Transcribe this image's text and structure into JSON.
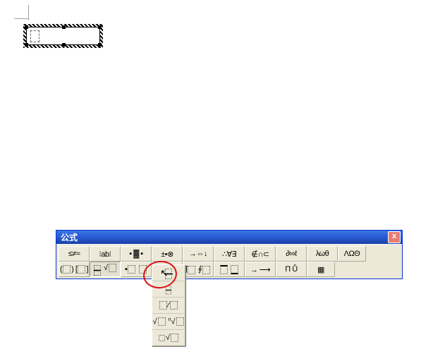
{
  "editor": {
    "placeholder_name": "equation-object",
    "slot_name": "input-slot"
  },
  "window": {
    "title": "公式",
    "close_label": "x"
  },
  "row1": [
    {
      "name": "relational-symbols",
      "label": "≤≠≈"
    },
    {
      "name": "spaces-dots",
      "label": "⁝ab⁝"
    },
    {
      "name": "embellishments",
      "label": "▪ ▓ ▪"
    },
    {
      "name": "operators",
      "label": "±•⊗"
    },
    {
      "name": "arrows",
      "label": "→⇔↓"
    },
    {
      "name": "logical",
      "label": "∴∀∃"
    },
    {
      "name": "set-theory",
      "label": "∉∩⊂"
    },
    {
      "name": "misc-symbols",
      "label": "∂∞ℓ"
    },
    {
      "name": "greek-lower",
      "label": "λωθ"
    },
    {
      "name": "greek-upper",
      "label": "ΛΩΘ"
    }
  ],
  "row2": [
    {
      "name": "fences",
      "type": "fence"
    },
    {
      "name": "fractions-radicals",
      "type": "frac",
      "pressed": true
    },
    {
      "name": "sub-super",
      "type": "subsup"
    },
    {
      "name": "summation",
      "type": "sum"
    },
    {
      "name": "integral",
      "type": "int"
    },
    {
      "name": "over-under-bar",
      "type": "bar"
    },
    {
      "name": "labeled-arrows",
      "type": "larrow"
    },
    {
      "name": "products",
      "type": "prod"
    },
    {
      "name": "matrices",
      "type": "matrix"
    }
  ],
  "popup": [
    {
      "name": "fraction-full",
      "type": "frac-full"
    },
    {
      "name": "fraction-small",
      "type": "frac-small"
    },
    {
      "name": "fraction-slash",
      "type": "frac-slash"
    },
    {
      "name": "radical",
      "type": "sqrt"
    },
    {
      "name": "nth-root",
      "type": "nroot"
    }
  ],
  "colors": {
    "accent": "#1941a5",
    "close_btn": "#e57e73",
    "annotation": "#d11"
  }
}
